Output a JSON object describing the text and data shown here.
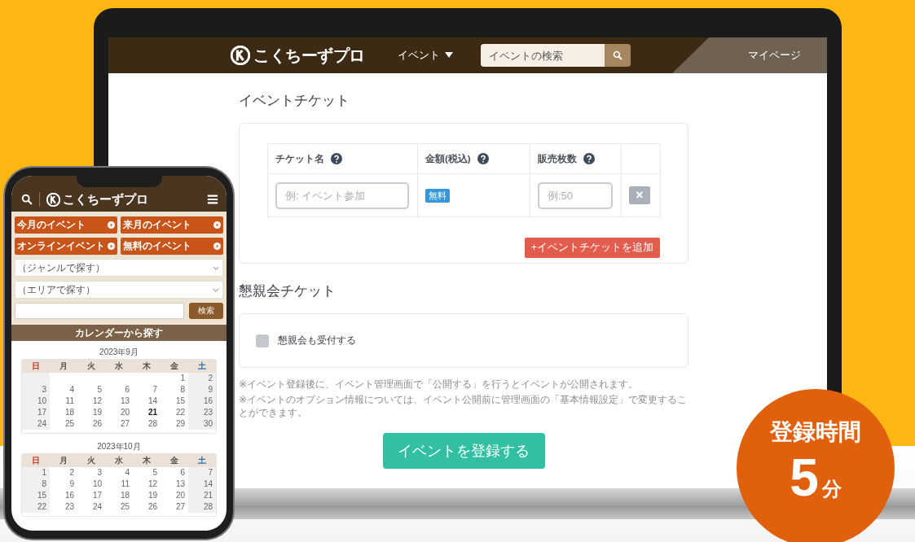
{
  "site": {
    "logo": "こくちーずプロ",
    "nav": [
      {
        "label": "イベント",
        "dropdown": true
      }
    ],
    "search": {
      "placeholder": "イベントの検索"
    },
    "account": "マイページ"
  },
  "ticket_section": {
    "title": "イベントチケット",
    "columns": [
      {
        "label": "チケット名",
        "help": true
      },
      {
        "label": "金額(税込)",
        "help": true
      },
      {
        "label": "販売枚数",
        "help": true
      }
    ],
    "row": {
      "name": {
        "placeholder": "例: イベント参加"
      },
      "price_tag": "無料",
      "quantity": {
        "placeholder": "例:50"
      },
      "remove": "×"
    },
    "add_button": "+イベントチケットを追加"
  },
  "party_section": {
    "title": "懇親会チケット",
    "checkbox": {
      "label": "懇親会も受付する",
      "checked": false
    }
  },
  "notes": [
    "※イベント登録後に、イベント管理画面で「公開する」を行うとイベントが公開されます。",
    "※イベントのオプション情報については、イベント公開前に管理画面の「基本情報設定」で変更することができます。"
  ],
  "submit": "イベントを登録する",
  "phone": {
    "logo": "こくちーずプロ",
    "quick_links": [
      "今月のイベント",
      "来月のイベント",
      "オンラインイベント",
      "無料のイベント"
    ],
    "selects": [
      {
        "placeholder": "（ジャンルで探す）"
      },
      {
        "placeholder": "（エリアで探す）"
      }
    ],
    "search_button": "検索",
    "calendar_heading": "カレンダーから探す",
    "calendars": [
      {
        "title": "2023年9月",
        "weekdays": [
          {
            "label": "日",
            "color": "#c0392b"
          },
          {
            "label": "月",
            "color": "#555555"
          },
          {
            "label": "火",
            "color": "#555555"
          },
          {
            "label": "水",
            "color": "#555555"
          },
          {
            "label": "木",
            "color": "#555555"
          },
          {
            "label": "金",
            "color": "#555555"
          },
          {
            "label": "土",
            "color": "#2e6db4"
          }
        ],
        "weeks": [
          [
            "1",
            "2"
          ],
          [
            "3",
            "4",
            "5",
            "6",
            "7",
            "8",
            "9"
          ],
          [
            "10",
            "11",
            "12",
            "13",
            "14",
            "15",
            "16"
          ],
          [
            "17",
            "18",
            "19",
            "20",
            {
              "text": "21",
              "today": true
            },
            "22",
            "23"
          ],
          [
            "24",
            "25",
            "26",
            "27",
            "28",
            "29",
            "30"
          ]
        ]
      },
      {
        "title": "2023年10月",
        "weekdays": [
          {
            "label": "日",
            "color": "#c0392b"
          },
          {
            "label": "月",
            "color": "#555555"
          },
          {
            "label": "火",
            "color": "#555555"
          },
          {
            "label": "水",
            "color": "#555555"
          },
          {
            "label": "木",
            "color": "#555555"
          },
          {
            "label": "金",
            "color": "#555555"
          },
          {
            "label": "土",
            "color": "#2e6db4"
          }
        ],
        "weeks": [
          [
            "1",
            "2",
            "3",
            "4",
            "5",
            "6",
            "7"
          ],
          [
            "8",
            "9",
            "10",
            "11",
            "12",
            "13",
            "14"
          ],
          [
            "15",
            "16",
            "17",
            "18",
            "19",
            "20",
            "21"
          ],
          [
            "22",
            "23",
            "24",
            "25",
            "26",
            "27",
            "28"
          ]
        ]
      }
    ]
  },
  "badge": {
    "title": "登録時間",
    "value": "5",
    "unit": "分"
  }
}
